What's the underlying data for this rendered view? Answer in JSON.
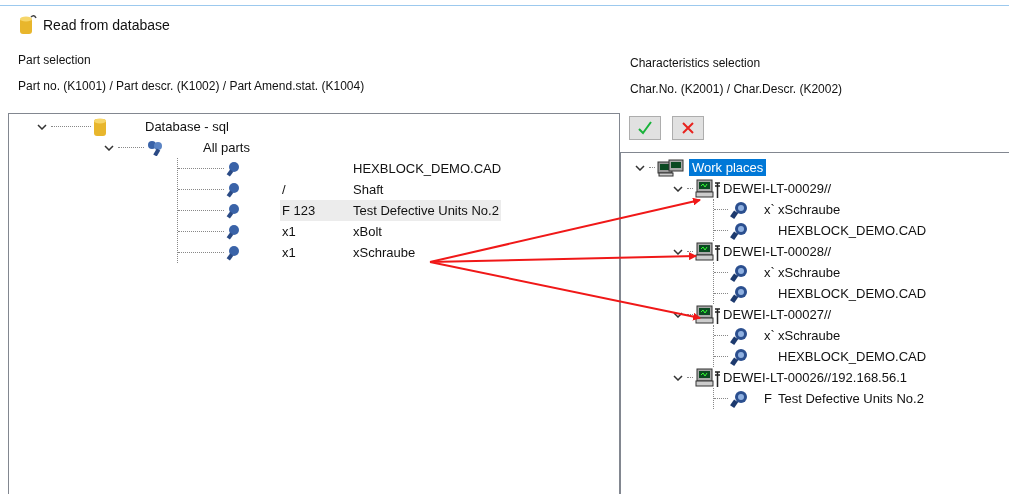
{
  "title": "Read from database",
  "part_selection": {
    "heading": "Part selection",
    "fields": "Part no. (K1001) / Part descr. (K1002) / Part Amend.stat. (K1004)"
  },
  "part_tree": {
    "label": "Database - sql",
    "expanded": true,
    "children": [
      {
        "label": "All parts",
        "expanded": true,
        "children": [
          {
            "description": "HEXBLOCK_DEMO.CAD",
            "selected": false
          },
          {
            "number": "/",
            "description": "Shaft",
            "selected": false
          },
          {
            "number": "F 123",
            "description": "Test Defective Units No.2",
            "selected": true
          },
          {
            "number": "x1",
            "description": "xBolt",
            "selected": false
          },
          {
            "number": "x1",
            "description": "xSchraube",
            "selected": false
          }
        ]
      }
    ]
  },
  "characteristics_selection": {
    "heading": "Characteristics selection",
    "fields": "Char.No. (K2001) / Char.Descr. (K2002)"
  },
  "work_places": {
    "label": "Work places",
    "selected": true,
    "expanded": true,
    "children": [
      {
        "label": "DEWEI-LT-00029//",
        "expanded": true,
        "children": [
          {
            "number": "x`",
            "description": "xSchraube"
          },
          {
            "description": "HEXBLOCK_DEMO.CAD"
          }
        ]
      },
      {
        "label": "DEWEI-LT-00028//",
        "expanded": true,
        "children": [
          {
            "number": "x`",
            "description": "xSchraube"
          },
          {
            "description": "HEXBLOCK_DEMO.CAD"
          }
        ]
      },
      {
        "label": "DEWEI-LT-00027//",
        "expanded": true,
        "children": [
          {
            "number": "x`",
            "description": "xSchraube"
          },
          {
            "description": "HEXBLOCK_DEMO.CAD"
          }
        ]
      },
      {
        "label": "DEWEI-LT-00026//192.168.56.1",
        "expanded": true,
        "children": [
          {
            "number": "F",
            "description": "Test Defective Units No.2"
          }
        ]
      }
    ]
  }
}
